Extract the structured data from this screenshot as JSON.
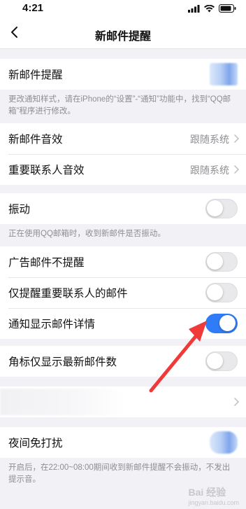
{
  "status_bar": {
    "time": "4:21"
  },
  "nav": {
    "title": "新邮件提醒"
  },
  "new_mail_alert": {
    "label": "新邮件提醒"
  },
  "note1": "更改通知样式，请在iPhone的“设置”-“通知”功能中，找到“QQ邮箱”程序进行修改。",
  "sound_rows": [
    {
      "label": "新邮件音效",
      "value": "跟随系统"
    },
    {
      "label": "重要联系人音效",
      "value": "跟随系统"
    }
  ],
  "vibration": {
    "label": "振动",
    "enabled": false
  },
  "note2": "正在使用QQ邮箱时，收到新邮件是否振动。",
  "toggles": [
    {
      "label": "广告邮件不提醒",
      "enabled": false
    },
    {
      "label": "仅提醒重要联系人的邮件",
      "enabled": false
    },
    {
      "label": "通知显示邮件详情",
      "enabled": true
    }
  ],
  "badge": {
    "label": "角标仅显示最新邮件数",
    "enabled": false
  },
  "night": {
    "label": "夜间免打扰"
  },
  "note3": "开启后，在22:00~08:00期间收到新邮件提醒不会振动，不发出提示音。",
  "watermark": {
    "brand": "Bai 经验",
    "site": "jingyan.baidu.com"
  },
  "colors": {
    "accent": "#2f7cf6",
    "arrow": "#f03a3a"
  }
}
